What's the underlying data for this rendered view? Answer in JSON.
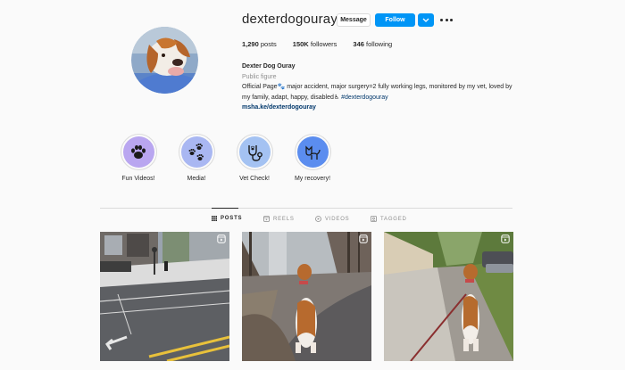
{
  "profile": {
    "username": "dexterdogouray",
    "message_label": "Message",
    "follow_label": "Follow",
    "stats": {
      "posts": "1,290",
      "posts_label": " posts",
      "followers": "150K",
      "followers_label": " followers",
      "following": "346",
      "following_label": " following"
    },
    "bio": {
      "name": "Dexter Dog Ouray",
      "category": "Public figure",
      "text": "Official Page🐾 major accident, major surgery=2 fully working legs, monitored by my vet, loved by my family, adapt, happy, disabled♿ ",
      "hashtag": "#dexterdogouray",
      "link": "msha.ke/dexterdogouray"
    }
  },
  "highlights": [
    {
      "label": "Fun Videos!",
      "icon": "paw-icon"
    },
    {
      "label": "Media!",
      "icon": "paws-icon"
    },
    {
      "label": "Vet Check!",
      "icon": "stethoscope-icon"
    },
    {
      "label": "My recovery!",
      "icon": "dog-icon"
    }
  ],
  "tabs": [
    {
      "label": "POSTS",
      "icon": "grid-icon",
      "active": true
    },
    {
      "label": "REELS",
      "icon": "reels-icon",
      "active": false
    },
    {
      "label": "VIDEOS",
      "icon": "video-icon",
      "active": false
    },
    {
      "label": "TAGGED",
      "icon": "tag-icon",
      "active": false
    }
  ],
  "posts": [
    {
      "type": "reel",
      "icon": "reel-icon"
    },
    {
      "type": "reel",
      "icon": "reel-icon"
    },
    {
      "type": "reel",
      "icon": "reel-icon"
    }
  ],
  "colors": {
    "accent": "#0095f6",
    "background": "#fafafa",
    "text": "#262626",
    "muted": "#8e8e8e",
    "link": "#00376b"
  }
}
